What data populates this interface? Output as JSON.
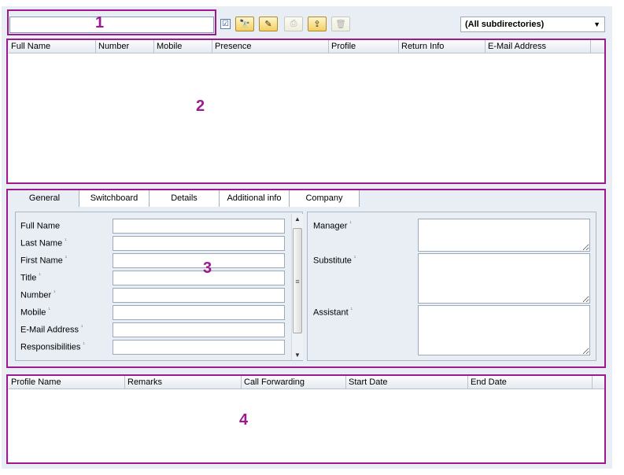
{
  "callouts": [
    "1",
    "2",
    "3",
    "4"
  ],
  "toolbar": {
    "search_value": "",
    "checkbox_mark": "☑",
    "buttons": [
      {
        "name": "binoculars-icon",
        "glyph": "🔭",
        "enabled": true
      },
      {
        "name": "edit-icon",
        "glyph": "✎",
        "enabled": true
      },
      {
        "name": "print-icon",
        "glyph": "⎙",
        "enabled": false
      },
      {
        "name": "export-icon",
        "glyph": "⇪",
        "enabled": true
      },
      {
        "name": "delete-icon",
        "glyph": "🗑",
        "enabled": false
      }
    ],
    "directory_selected": "(All subdirectories)"
  },
  "contacts_table": {
    "columns": [
      "Full Name",
      "Number",
      "Mobile",
      "Presence",
      "Profile",
      "Return Info",
      "E-Mail Address"
    ],
    "rows": []
  },
  "tabs": [
    "General",
    "Switchboard",
    "Details",
    "Additional info",
    "Company"
  ],
  "active_tab": "General",
  "general_form": {
    "left_fields": [
      {
        "label": "Full Name",
        "required_mark": "",
        "value": ""
      },
      {
        "label": "Last Name",
        "required_mark": "¹",
        "value": ""
      },
      {
        "label": "First Name",
        "required_mark": "¹",
        "value": ""
      },
      {
        "label": "Title",
        "required_mark": "¹",
        "value": ""
      },
      {
        "label": "Number",
        "required_mark": "¹",
        "value": ""
      },
      {
        "label": "Mobile",
        "required_mark": "¹",
        "value": ""
      },
      {
        "label": "E-Mail Address",
        "required_mark": "¹",
        "value": ""
      },
      {
        "label": "Responsibilities",
        "required_mark": "¹",
        "value": ""
      }
    ],
    "right_fields": [
      {
        "label": "Manager",
        "required_mark": "¹",
        "value": ""
      },
      {
        "label": "Substitute",
        "required_mark": "¹",
        "value": ""
      },
      {
        "label": "Assistant",
        "required_mark": "¹",
        "value": ""
      }
    ]
  },
  "profiles_table": {
    "columns": [
      "Profile Name",
      "Remarks",
      "Call Forwarding",
      "Start Date",
      "End Date"
    ],
    "rows": []
  },
  "colors": {
    "callout": "#9c1a8e",
    "panel_bg": "#e9eef5",
    "button_gold": "#f2cf63"
  }
}
